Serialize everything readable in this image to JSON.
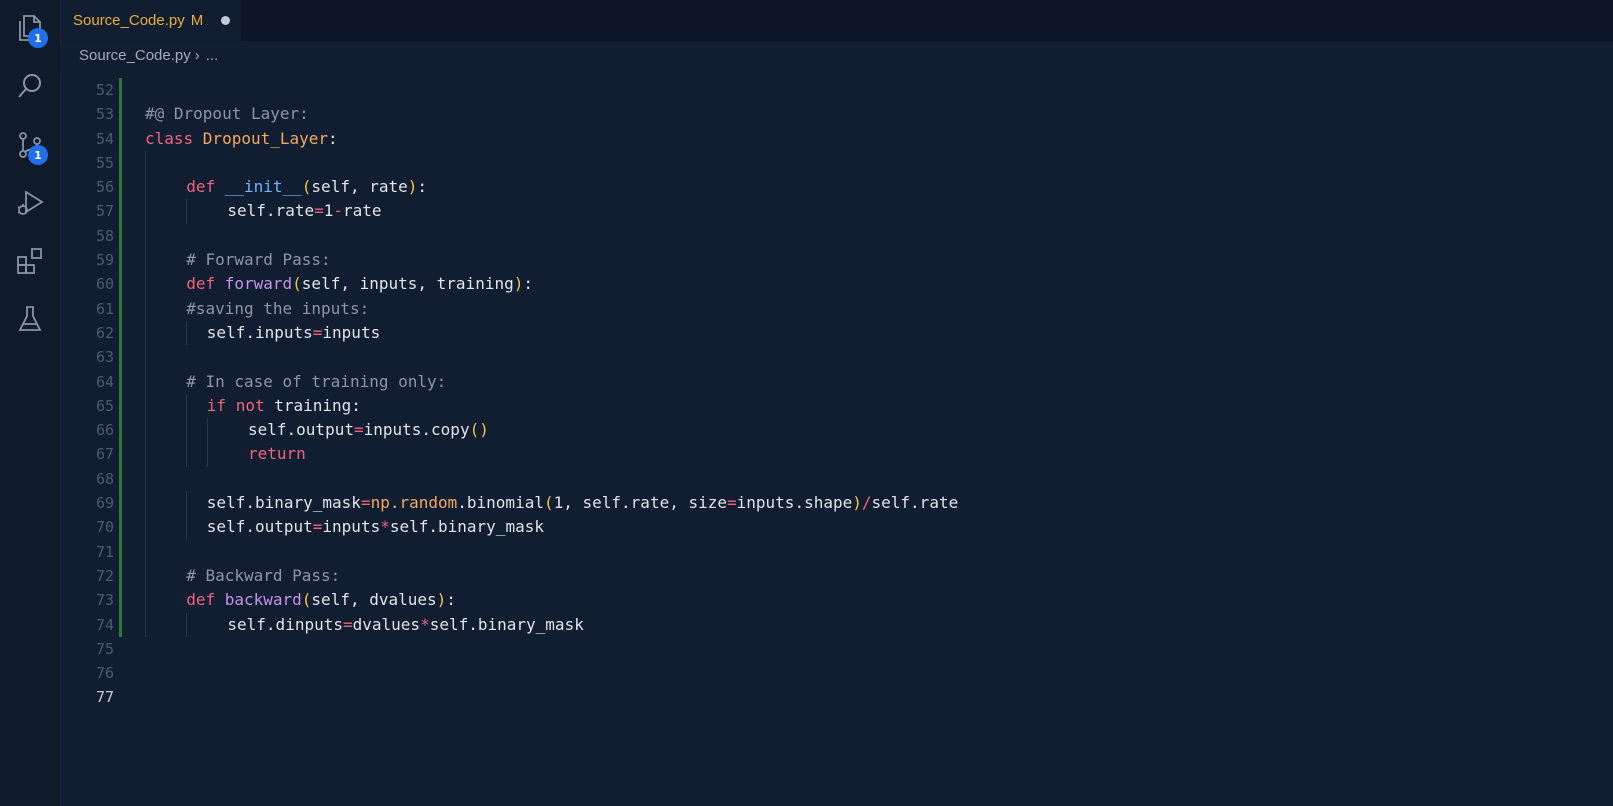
{
  "activity_bar": {
    "explorer_badge": "1",
    "source_control_badge": "1"
  },
  "tab": {
    "filename": "Source_Code.py",
    "status": "M"
  },
  "breadcrumb": {
    "file": "Source_Code.py",
    "separator": "›",
    "rest": "..."
  },
  "editor": {
    "current_line": 77,
    "lines": [
      {
        "n": "52",
        "indent": 0,
        "tokens": []
      },
      {
        "n": "53",
        "indent": 0,
        "tokens": [
          {
            "t": "#@ Dropout Layer:",
            "c": "cm"
          }
        ]
      },
      {
        "n": "54",
        "indent": 0,
        "tokens": [
          {
            "t": "class ",
            "c": "kw"
          },
          {
            "t": "Dropout_Layer",
            "c": "cls"
          },
          {
            "t": ":",
            "c": ""
          }
        ]
      },
      {
        "n": "55",
        "indent": 0,
        "tokens": []
      },
      {
        "n": "56",
        "indent": 4,
        "tokens": [
          {
            "t": "def ",
            "c": "kw"
          },
          {
            "t": "__init__",
            "c": "dunder"
          },
          {
            "t": "(",
            "c": "par"
          },
          {
            "t": "self, rate",
            "c": ""
          },
          {
            "t": ")",
            "c": "par"
          },
          {
            "t": ":",
            "c": ""
          }
        ]
      },
      {
        "n": "57",
        "indent": 8,
        "tokens": [
          {
            "t": "self.rate",
            "c": ""
          },
          {
            "t": "=",
            "c": "op"
          },
          {
            "t": "1",
            "c": "num"
          },
          {
            "t": "-",
            "c": "op"
          },
          {
            "t": "rate",
            "c": ""
          }
        ]
      },
      {
        "n": "58",
        "indent": 0,
        "tokens": []
      },
      {
        "n": "59",
        "indent": 4,
        "tokens": [
          {
            "t": "# Forward Pass:",
            "c": "cm"
          }
        ]
      },
      {
        "n": "60",
        "indent": 4,
        "tokens": [
          {
            "t": "def ",
            "c": "kw"
          },
          {
            "t": "forward",
            "c": "fn"
          },
          {
            "t": "(",
            "c": "par"
          },
          {
            "t": "self, inputs, training",
            "c": ""
          },
          {
            "t": ")",
            "c": "par"
          },
          {
            "t": ":",
            "c": ""
          }
        ]
      },
      {
        "n": "61",
        "indent": 4,
        "tokens": [
          {
            "t": "#saving the inputs:",
            "c": "cm"
          }
        ]
      },
      {
        "n": "62",
        "indent": 6,
        "tokens": [
          {
            "t": "self.inputs",
            "c": ""
          },
          {
            "t": "=",
            "c": "op"
          },
          {
            "t": "inputs",
            "c": ""
          }
        ]
      },
      {
        "n": "63",
        "indent": 0,
        "tokens": []
      },
      {
        "n": "64",
        "indent": 4,
        "tokens": [
          {
            "t": "# In case of training only:",
            "c": "cm"
          }
        ]
      },
      {
        "n": "65",
        "indent": 6,
        "tokens": [
          {
            "t": "if ",
            "c": "kw"
          },
          {
            "t": "not ",
            "c": "kw"
          },
          {
            "t": "training:",
            "c": ""
          }
        ]
      },
      {
        "n": "66",
        "indent": 10,
        "tokens": [
          {
            "t": "self.output",
            "c": ""
          },
          {
            "t": "=",
            "c": "op"
          },
          {
            "t": "inputs.copy",
            "c": ""
          },
          {
            "t": "()",
            "c": "par"
          }
        ]
      },
      {
        "n": "67",
        "indent": 10,
        "tokens": [
          {
            "t": "return",
            "c": "kw"
          }
        ]
      },
      {
        "n": "68",
        "indent": 0,
        "tokens": []
      },
      {
        "n": "69",
        "indent": 6,
        "tokens": [
          {
            "t": "self.binary_mask",
            "c": ""
          },
          {
            "t": "=",
            "c": "op"
          },
          {
            "t": "np.",
            "c": "attr"
          },
          {
            "t": "random",
            "c": "attr"
          },
          {
            "t": ".binomial",
            "c": ""
          },
          {
            "t": "(",
            "c": "par"
          },
          {
            "t": "1, self.rate, size",
            "c": ""
          },
          {
            "t": "=",
            "c": "op"
          },
          {
            "t": "inputs.shape",
            "c": ""
          },
          {
            "t": ")",
            "c": "par"
          },
          {
            "t": "/",
            "c": "op"
          },
          {
            "t": "self.rate",
            "c": ""
          }
        ]
      },
      {
        "n": "70",
        "indent": 6,
        "tokens": [
          {
            "t": "self.output",
            "c": ""
          },
          {
            "t": "=",
            "c": "op"
          },
          {
            "t": "inputs",
            "c": ""
          },
          {
            "t": "*",
            "c": "op"
          },
          {
            "t": "self.binary_mask",
            "c": ""
          }
        ]
      },
      {
        "n": "71",
        "indent": 0,
        "tokens": []
      },
      {
        "n": "72",
        "indent": 4,
        "tokens": [
          {
            "t": "# Backward Pass:",
            "c": "cm"
          }
        ]
      },
      {
        "n": "73",
        "indent": 4,
        "tokens": [
          {
            "t": "def ",
            "c": "kw"
          },
          {
            "t": "backward",
            "c": "fn"
          },
          {
            "t": "(",
            "c": "par"
          },
          {
            "t": "self, dvalues",
            "c": ""
          },
          {
            "t": ")",
            "c": "par"
          },
          {
            "t": ":",
            "c": ""
          }
        ]
      },
      {
        "n": "74",
        "indent": 8,
        "tokens": [
          {
            "t": "self.dinputs",
            "c": ""
          },
          {
            "t": "=",
            "c": "op"
          },
          {
            "t": "dvalues",
            "c": ""
          },
          {
            "t": "*",
            "c": "op"
          },
          {
            "t": "self.binary_mask",
            "c": ""
          }
        ]
      },
      {
        "n": "75",
        "indent": 0,
        "tokens": []
      },
      {
        "n": "76",
        "indent": 0,
        "tokens": []
      },
      {
        "n": "77",
        "indent": 0,
        "tokens": []
      }
    ]
  }
}
